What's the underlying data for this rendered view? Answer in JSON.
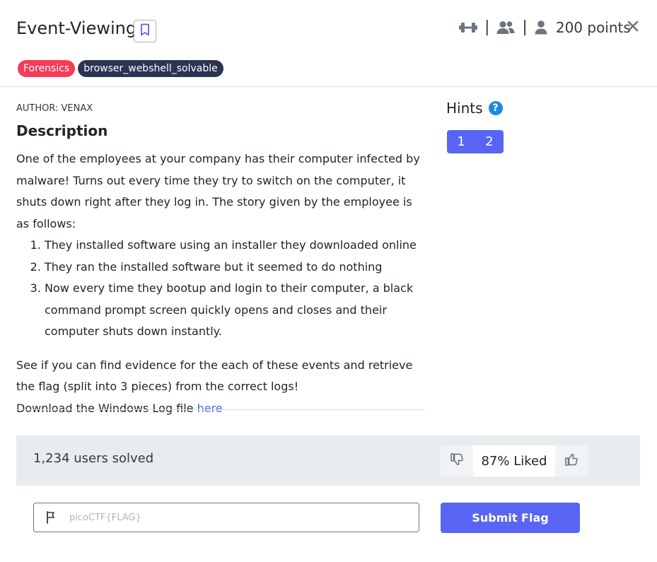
{
  "header": {
    "title": "Event-Viewing",
    "points": "200 points",
    "separator": "|",
    "icons": [
      "dumbbell-icon",
      "users-icon",
      "user-icon"
    ]
  },
  "tags": [
    {
      "label": "Forensics",
      "color": "#f53b57"
    },
    {
      "label": "browser_webshell_solvable",
      "color": "#2d3452"
    }
  ],
  "challenge": {
    "author": "AUTHOR: VENAX",
    "description_title": "Description",
    "intro": "One of the employees at your company has their computer infected by malware! Turns out every time they try to switch on the computer, it shuts down right after they log in. The story given by the employee is as follows:",
    "steps": [
      "They installed software using an installer they downloaded online",
      "They ran the installed software but it seemed to do nothing",
      "Now every time they bootup and login to their computer, a black command prompt screen quickly opens and closes and their computer shuts down instantly."
    ],
    "evidence_text": "See if you can find evidence for the each of these events and retrieve the flag (split into 3 pieces) from the correct logs!",
    "download_text": "Download the Windows Log file ",
    "download_link": "here"
  },
  "hints": {
    "title": "Hints",
    "help": "?",
    "buttons": [
      "1",
      "2"
    ]
  },
  "stats": {
    "solved": "1,234 users solved",
    "liked": "87% Liked"
  },
  "submit": {
    "placeholder": "picoCTF{FLAG}",
    "button_label": "Submit Flag"
  },
  "colors": {
    "accent": "#5865f2",
    "forensics_tag": "#f53b57",
    "dark_tag": "#2d3452",
    "help_icon": "#1e88e5"
  }
}
